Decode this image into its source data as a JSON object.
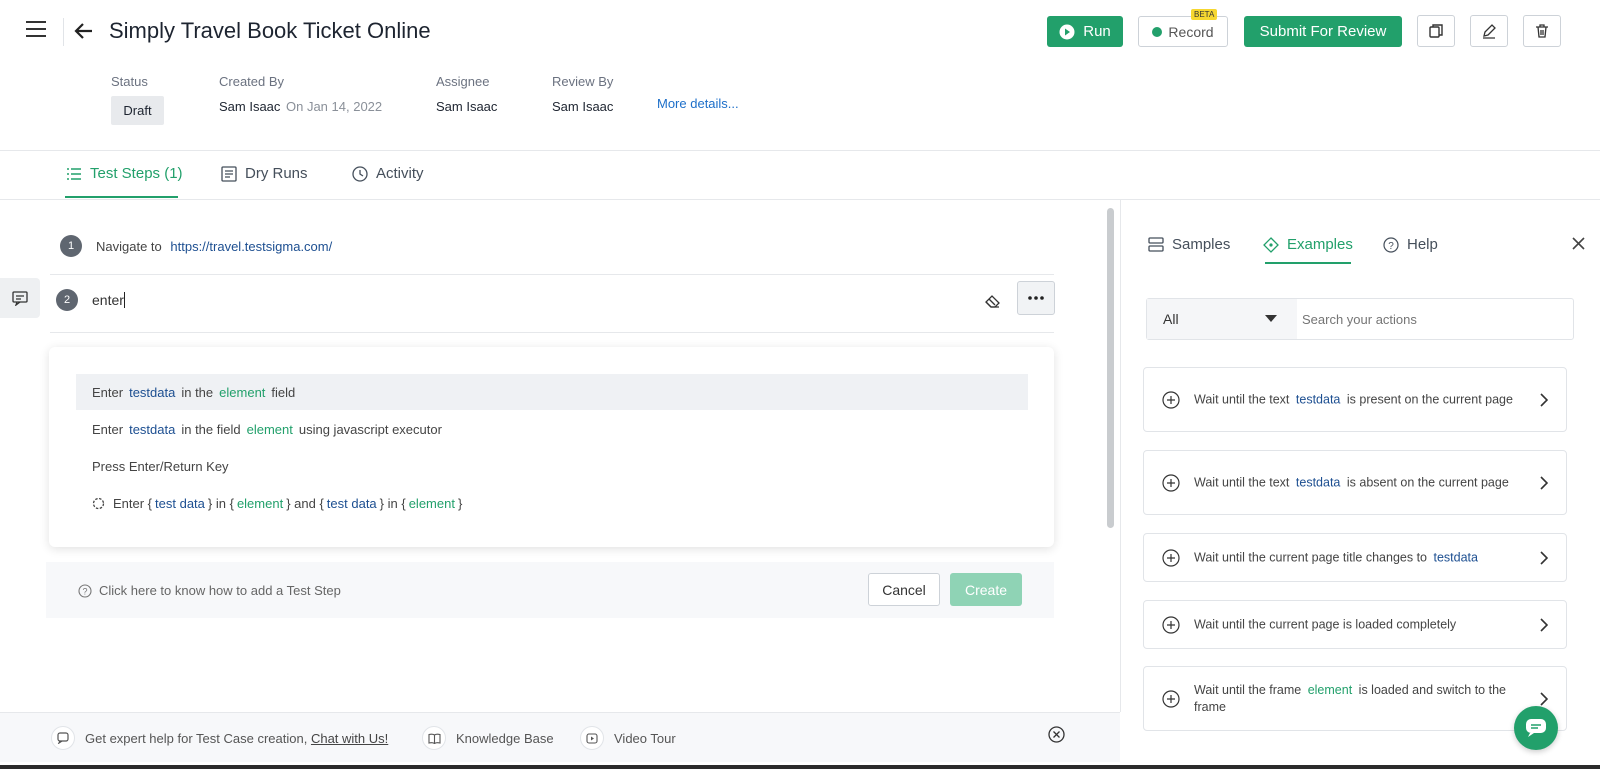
{
  "header": {
    "title": "Simply Travel Book Ticket Online",
    "run_label": "Run",
    "record_label": "Record",
    "record_badge": "BETA",
    "submit_label": "Submit For Review"
  },
  "meta": {
    "status_label": "Status",
    "status_value": "Draft",
    "created_by_label": "Created By",
    "created_by_name": "Sam Isaac",
    "created_on": "On Jan 14, 2022",
    "assignee_label": "Assignee",
    "assignee_value": "Sam Isaac",
    "review_by_label": "Review By",
    "review_by_value": "Sam Isaac",
    "more_details": "More details..."
  },
  "tabs": [
    {
      "label": "Test Steps (1)"
    },
    {
      "label": "Dry Runs"
    },
    {
      "label": "Activity"
    }
  ],
  "steps": {
    "step1_num": "1",
    "step1_text": "Navigate to",
    "step1_url": "https://travel.testsigma.com/",
    "step2_num": "2",
    "step2_input": "enter"
  },
  "suggestions": {
    "s1": {
      "a": "Enter",
      "b": "testdata",
      "c": "in the",
      "d": "element",
      "e": "field"
    },
    "s2": {
      "a": "Enter",
      "b": "testdata",
      "c": "in the field",
      "d": "element",
      "e": "using javascript executor"
    },
    "s3": {
      "a": "Press Enter/Return Key"
    },
    "s4": {
      "a": "Enter {",
      "b": "test data",
      "c": "} in {",
      "d": "element",
      "e": "} and {",
      "f": "test data",
      "g": "} in {",
      "h": "element",
      "i": "}"
    }
  },
  "helpbar": {
    "text": "Click here to know how to add a Test Step",
    "cancel_label": "Cancel",
    "create_label": "Create"
  },
  "right_panel": {
    "tabs": [
      {
        "label": "Samples"
      },
      {
        "label": "Examples"
      },
      {
        "label": "Help"
      }
    ],
    "filter_value": "All",
    "search_placeholder": "Search your actions",
    "cards": {
      "c1": {
        "a": "Wait until the text",
        "b": "testdata",
        "c": "is present on the current page"
      },
      "c2": {
        "a": "Wait until the text",
        "b": "testdata",
        "c": "is absent on the current page"
      },
      "c3": {
        "a": "Wait until the current page title changes to",
        "b": "testdata"
      },
      "c4": {
        "a": "Wait until the current page is loaded completely"
      },
      "c5": {
        "a": "Wait until the frame",
        "b": "element",
        "c": "is loaded and switch to the frame"
      }
    }
  },
  "footer": {
    "expert_text": "Get expert help for Test Case creation,",
    "chat_link": "Chat with Us!",
    "kb_label": "Knowledge Base",
    "video_label": "Video Tour"
  },
  "colors": {
    "accent": "#22a06b",
    "link": "#1d4f91"
  }
}
